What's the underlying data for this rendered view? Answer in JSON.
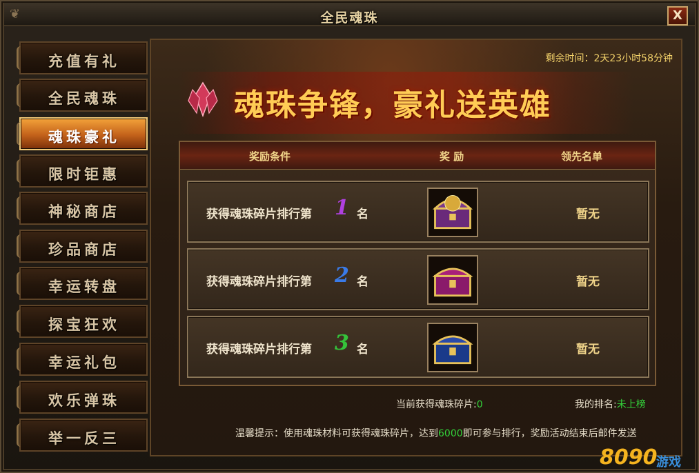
{
  "window": {
    "title": "全民魂珠",
    "close_label": "X"
  },
  "sidebar": {
    "items": [
      {
        "label": "充值有礼",
        "active": false
      },
      {
        "label": "全民魂珠",
        "active": false
      },
      {
        "label": "魂珠豪礼",
        "active": true
      },
      {
        "label": "限时钜惠",
        "active": false
      },
      {
        "label": "神秘商店",
        "active": false
      },
      {
        "label": "珍品商店",
        "active": false
      },
      {
        "label": "幸运转盘",
        "active": false
      },
      {
        "label": "探宝狂欢",
        "active": false
      },
      {
        "label": "幸运礼包",
        "active": false
      },
      {
        "label": "欢乐弹珠",
        "active": false
      },
      {
        "label": "举一反三",
        "active": false
      }
    ]
  },
  "main": {
    "remaining_time": "剩余时间：2天23小时58分钟",
    "banner_text": "魂珠争锋，豪礼送英雄",
    "table": {
      "headers": {
        "condition": "奖励条件",
        "reward": "奖  励",
        "leaders": "领先名单"
      },
      "rows": [
        {
          "condition": "获得魂珠碎片排行第",
          "rank": "1",
          "rank_color": "#b040e0",
          "unit": "名",
          "chest_icon": "gold-dragon-chest-icon",
          "leader": "暂无"
        },
        {
          "condition": "获得魂珠碎片排行第",
          "rank": "2",
          "rank_color": "#3a7be8",
          "unit": "名",
          "chest_icon": "purple-chest-icon",
          "leader": "暂无"
        },
        {
          "condition": "获得魂珠碎片排行第",
          "rank": "3",
          "rank_color": "#35c23a",
          "unit": "名",
          "chest_icon": "blue-chest-icon",
          "leader": "暂无"
        }
      ]
    },
    "current_fragments_label": "当前获得魂珠碎片:",
    "current_fragments_value": "0",
    "my_rank_label": "我的排名:",
    "my_rank_value": "未上榜",
    "tip_prefix": "温馨提示：使用魂珠材料可获得魂珠碎片，达到",
    "tip_value": "6000",
    "tip_suffix": "即可参与排行，奖励活动结束后邮件发送"
  },
  "watermark": {
    "num": "8090",
    "text": "游戏"
  }
}
